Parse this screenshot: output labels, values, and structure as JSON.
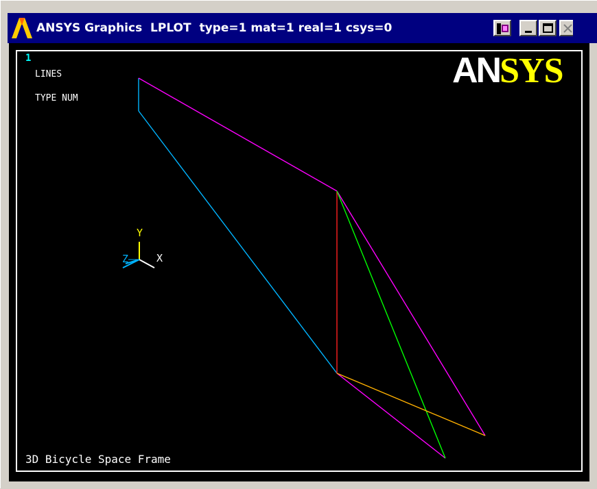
{
  "window": {
    "title": "ANSYS Graphics  LPLOT  type=1 mat=1 real=1 csys=0",
    "buttons": [
      "restore-icon",
      "minimize-icon",
      "maximize-icon",
      "close-icon"
    ]
  },
  "plot": {
    "window_number": "1",
    "label_lines": "LINES",
    "label_type_num": "TYPE NUM",
    "caption": "3D Bicycle Space Frame",
    "logo_an": "AN",
    "logo_sys": "SYS",
    "triad": {
      "x": "X",
      "y": "Y",
      "z": "Z"
    }
  },
  "colors": {
    "background": "#000000",
    "titlebar": "#000080",
    "magenta": "#ff00ff",
    "cyan": "#00b4ff",
    "red": "#ff2020",
    "green": "#00ff00",
    "orange": "#ffb000",
    "yellow": "#ffff00"
  }
}
